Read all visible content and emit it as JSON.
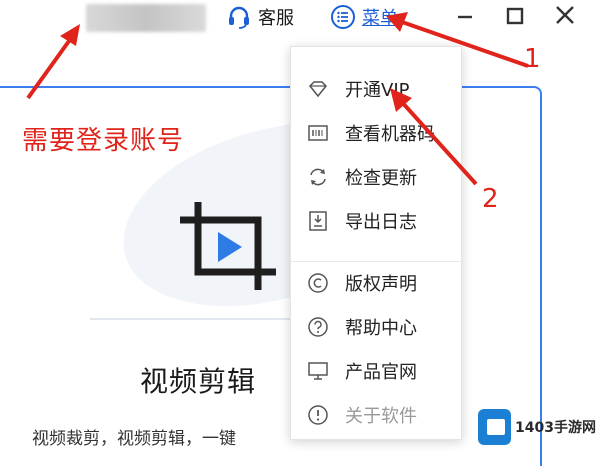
{
  "titlebar": {
    "service_label": "客服",
    "menu_label": "菜单"
  },
  "annotations": {
    "login_note": "需要登录账号",
    "step1": "1",
    "step2": "2"
  },
  "menu": {
    "items": [
      {
        "label": "开通VIP",
        "icon": "diamond-icon"
      },
      {
        "label": "查看机器码",
        "icon": "barcode-icon"
      },
      {
        "label": "检查更新",
        "icon": "refresh-icon"
      },
      {
        "label": "导出日志",
        "icon": "log-export-icon"
      },
      {
        "label": "版权声明",
        "icon": "copyright-icon"
      },
      {
        "label": "帮助中心",
        "icon": "help-icon"
      },
      {
        "label": "产品官网",
        "icon": "monitor-icon"
      },
      {
        "label": "关于软件",
        "icon": "info-icon"
      }
    ]
  },
  "main": {
    "heading": "视频剪辑",
    "subtext": "视频裁剪，视频剪辑，一键"
  },
  "watermark": {
    "text": "1403手游网"
  },
  "colors": {
    "accent": "#3b7ef0",
    "annotation": "#e0241b",
    "menu_link": "#1a5fd6"
  }
}
